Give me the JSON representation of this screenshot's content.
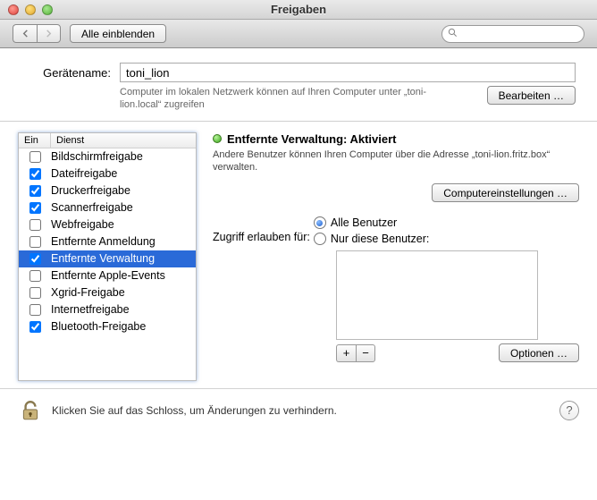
{
  "window": {
    "title": "Freigaben"
  },
  "toolbar": {
    "show_all": "Alle einblenden",
    "search_placeholder": ""
  },
  "device": {
    "label": "Gerätename:",
    "value": "toni_lion",
    "hint": "Computer im lokalen Netzwerk können auf Ihren Computer unter „toni-lion.local“ zugreifen",
    "edit_btn": "Bearbeiten …"
  },
  "listhead": {
    "on": "Ein",
    "service": "Dienst"
  },
  "services": [
    {
      "label": "Bildschirmfreigabe",
      "checked": false,
      "selected": false
    },
    {
      "label": "Dateifreigabe",
      "checked": true,
      "selected": false
    },
    {
      "label": "Druckerfreigabe",
      "checked": true,
      "selected": false
    },
    {
      "label": "Scannerfreigabe",
      "checked": true,
      "selected": false
    },
    {
      "label": "Webfreigabe",
      "checked": false,
      "selected": false
    },
    {
      "label": "Entfernte Anmeldung",
      "checked": false,
      "selected": false
    },
    {
      "label": "Entfernte Verwaltung",
      "checked": true,
      "selected": true
    },
    {
      "label": "Entfernte Apple-Events",
      "checked": false,
      "selected": false
    },
    {
      "label": "Xgrid-Freigabe",
      "checked": false,
      "selected": false
    },
    {
      "label": "Internetfreigabe",
      "checked": false,
      "selected": false
    },
    {
      "label": "Bluetooth-Freigabe",
      "checked": true,
      "selected": false
    }
  ],
  "detail": {
    "status_title": "Entfernte Verwaltung: Aktiviert",
    "desc": "Andere Benutzer können Ihren Computer über die Adresse „toni-lion.fritz.box“ verwalten.",
    "computer_settings_btn": "Computereinstellungen …",
    "access_label": "Zugriff erlauben für:",
    "radio_all": "Alle Benutzer",
    "radio_these": "Nur diese Benutzer:",
    "options_btn": "Optionen …",
    "plus": "+",
    "minus": "−"
  },
  "footer": {
    "text": "Klicken Sie auf das Schloss, um Änderungen zu verhindern.",
    "help": "?"
  }
}
